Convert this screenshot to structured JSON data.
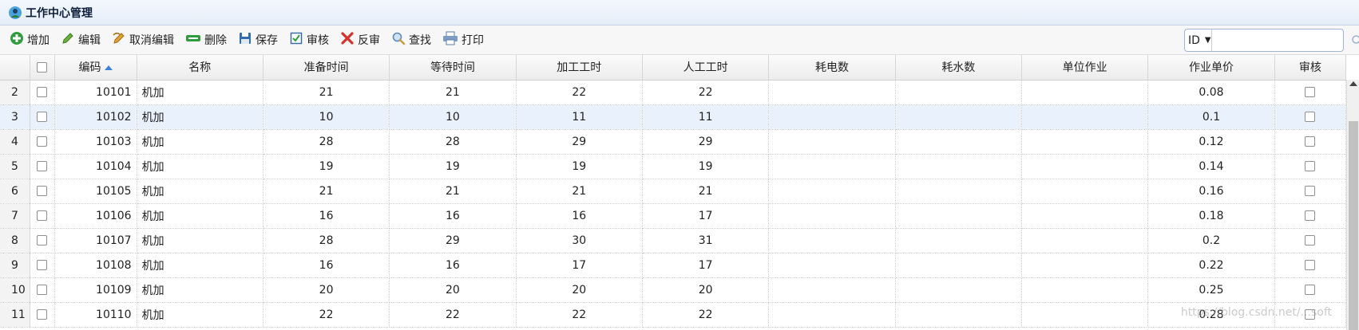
{
  "app": {
    "title": "工作中心管理"
  },
  "toolbar": {
    "buttons": [
      {
        "label": "增加",
        "icon": "add-icon"
      },
      {
        "label": "编辑",
        "icon": "pencil-icon"
      },
      {
        "label": "取消编辑",
        "icon": "undo-icon"
      },
      {
        "label": "删除",
        "icon": "minus-icon"
      },
      {
        "label": "保存",
        "icon": "save-icon"
      },
      {
        "label": "审核",
        "icon": "checkbox-icon"
      },
      {
        "label": "反审",
        "icon": "x-icon"
      },
      {
        "label": "查找",
        "icon": "magnifier-icon"
      },
      {
        "label": "打印",
        "icon": "printer-icon"
      }
    ],
    "search": {
      "field": "ID",
      "value": ""
    }
  },
  "grid": {
    "headers": [
      "编码",
      "名称",
      "准备时间",
      "等待时间",
      "加工工时",
      "人工工时",
      "耗电数",
      "耗水数",
      "单位作业",
      "作业单价",
      "审核"
    ],
    "rows": [
      {
        "n": "2",
        "code": "10101",
        "name": "机加",
        "prep": "21",
        "wait": "21",
        "proc": "22",
        "labor": "22",
        "power": "",
        "water": "",
        "unit": "",
        "price": "0.08"
      },
      {
        "n": "3",
        "code": "10102",
        "name": "机加",
        "prep": "10",
        "wait": "10",
        "proc": "11",
        "labor": "11",
        "power": "",
        "water": "",
        "unit": "",
        "price": "0.1"
      },
      {
        "n": "4",
        "code": "10103",
        "name": "机加",
        "prep": "28",
        "wait": "28",
        "proc": "29",
        "labor": "29",
        "power": "",
        "water": "",
        "unit": "",
        "price": "0.12"
      },
      {
        "n": "5",
        "code": "10104",
        "name": "机加",
        "prep": "19",
        "wait": "19",
        "proc": "19",
        "labor": "19",
        "power": "",
        "water": "",
        "unit": "",
        "price": "0.14"
      },
      {
        "n": "6",
        "code": "10105",
        "name": "机加",
        "prep": "21",
        "wait": "21",
        "proc": "21",
        "labor": "21",
        "power": "",
        "water": "",
        "unit": "",
        "price": "0.16"
      },
      {
        "n": "7",
        "code": "10106",
        "name": "机加",
        "prep": "16",
        "wait": "16",
        "proc": "16",
        "labor": "17",
        "power": "",
        "water": "",
        "unit": "",
        "price": "0.18"
      },
      {
        "n": "8",
        "code": "10107",
        "name": "机加",
        "prep": "28",
        "wait": "29",
        "proc": "30",
        "labor": "31",
        "power": "",
        "water": "",
        "unit": "",
        "price": "0.2"
      },
      {
        "n": "9",
        "code": "10108",
        "name": "机加",
        "prep": "16",
        "wait": "16",
        "proc": "17",
        "labor": "17",
        "power": "",
        "water": "",
        "unit": "",
        "price": "0.22"
      },
      {
        "n": "10",
        "code": "10109",
        "name": "机加",
        "prep": "20",
        "wait": "20",
        "proc": "20",
        "labor": "20",
        "power": "",
        "water": "",
        "unit": "",
        "price": "0.25"
      },
      {
        "n": "11",
        "code": "10110",
        "name": "机加",
        "prep": "22",
        "wait": "22",
        "proc": "22",
        "labor": "22",
        "power": "",
        "water": "",
        "unit": "",
        "price": "0.28"
      }
    ],
    "selected_row_index": 1
  },
  "watermark": "https://blog.csdn.net/...soft"
}
